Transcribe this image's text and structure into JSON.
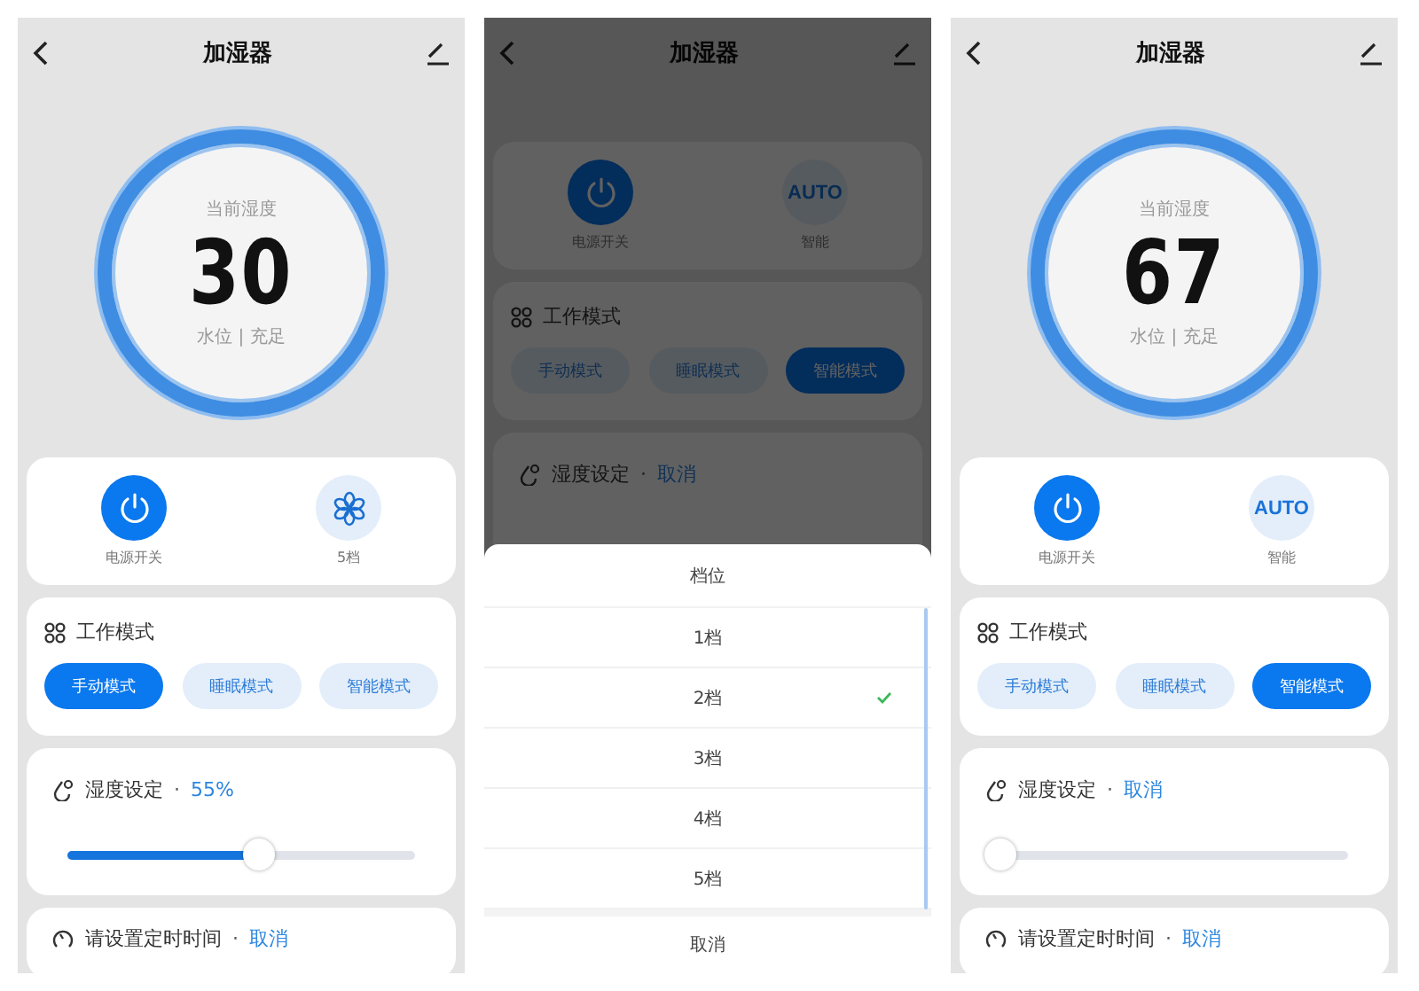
{
  "screens": [
    {
      "title": "加湿器",
      "dial": {
        "label": "当前湿度",
        "value": "30",
        "status": "水位 | 充足"
      },
      "controls": [
        {
          "kind": "power",
          "label": "电源开关",
          "on": true
        },
        {
          "kind": "fan",
          "label": "5档",
          "on": false
        }
      ],
      "mode": {
        "title": "工作模式",
        "options": [
          {
            "label": "手动模式",
            "selected": true
          },
          {
            "label": "睡眠模式",
            "selected": false
          },
          {
            "label": "智能模式",
            "selected": false
          }
        ]
      },
      "humidity": {
        "title": "湿度设定",
        "separator": "·",
        "value": "55%",
        "level": 0.55
      },
      "timer": {
        "title": "请设置定时时间",
        "separator": "·",
        "action": "取消"
      }
    },
    {
      "title": "加湿器",
      "controls": [
        {
          "kind": "power",
          "label": "电源开关",
          "on": true
        },
        {
          "kind": "text",
          "text": "AUTO",
          "label": "智能",
          "on": false
        }
      ],
      "mode": {
        "title": "工作模式",
        "options": [
          {
            "label": "手动模式",
            "selected": false
          },
          {
            "label": "睡眠模式",
            "selected": false
          },
          {
            "label": "智能模式",
            "selected": true
          }
        ]
      },
      "humidity": {
        "title": "湿度设定",
        "separator": "·",
        "value": "取消"
      },
      "sheet": {
        "title": "档位",
        "options": [
          {
            "label": "1档",
            "selected": false
          },
          {
            "label": "2档",
            "selected": true
          },
          {
            "label": "3档",
            "selected": false
          },
          {
            "label": "4档",
            "selected": false
          },
          {
            "label": "5档",
            "selected": false
          }
        ],
        "cancel": "取消"
      }
    },
    {
      "title": "加湿器",
      "dial": {
        "label": "当前湿度",
        "value": "67",
        "status": "水位 | 充足"
      },
      "controls": [
        {
          "kind": "power",
          "label": "电源开关",
          "on": true
        },
        {
          "kind": "text",
          "text": "AUTO",
          "label": "智能",
          "on": false
        }
      ],
      "mode": {
        "title": "工作模式",
        "options": [
          {
            "label": "手动模式",
            "selected": false
          },
          {
            "label": "睡眠模式",
            "selected": false
          },
          {
            "label": "智能模式",
            "selected": true
          }
        ]
      },
      "humidity": {
        "title": "湿度设定",
        "separator": "·",
        "value": "取消",
        "level": 0
      },
      "timer": {
        "title": "请设置定时时间",
        "separator": "·",
        "action": "取消"
      }
    }
  ]
}
